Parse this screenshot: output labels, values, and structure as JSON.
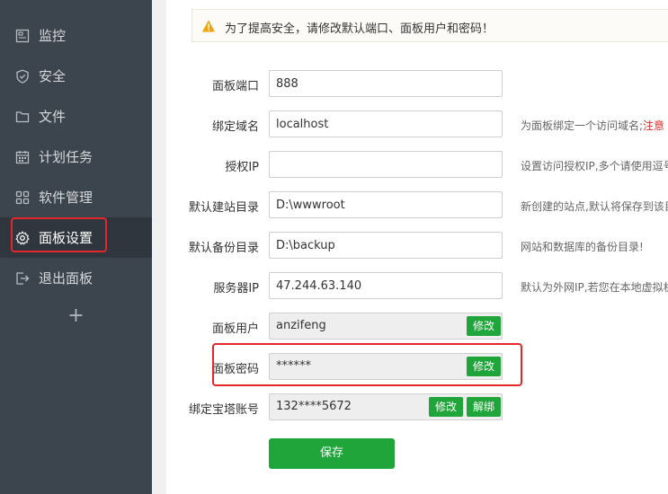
{
  "sidebar": {
    "items": [
      {
        "label": "监控",
        "icon": "monitor-icon"
      },
      {
        "label": "安全",
        "icon": "shield-icon"
      },
      {
        "label": "文件",
        "icon": "folder-icon"
      },
      {
        "label": "计划任务",
        "icon": "calendar-icon"
      },
      {
        "label": "软件管理",
        "icon": "apps-icon"
      },
      {
        "label": "面板设置",
        "icon": "gear-icon"
      },
      {
        "label": "退出面板",
        "icon": "logout-icon"
      }
    ],
    "add_label": "+"
  },
  "alert": {
    "message": "为了提高安全，请修改默认端口、面板用户和密码！",
    "icon": "warning-icon",
    "color": "#f0a30a"
  },
  "form": {
    "port": {
      "label": "面板端口",
      "value": "888"
    },
    "domain": {
      "label": "绑定域名",
      "value": "localhost",
      "hint": "为面板绑定一个访问域名;",
      "hint_red": "注意"
    },
    "auth_ip": {
      "label": "授权IP",
      "value": "",
      "hint": "设置访问授权IP,多个请使用逗号"
    },
    "site_dir": {
      "label": "默认建站目录",
      "value": "D:\\wwwroot",
      "hint": "新创建的站点,默认将保存到该目"
    },
    "backup_dir": {
      "label": "默认备份目录",
      "value": "D:\\backup",
      "hint": "网站和数据库的备份目录!"
    },
    "server_ip": {
      "label": "服务器IP",
      "value": "47.244.63.140",
      "hint": "默认为外网IP,若您在本地虚拟机"
    },
    "panel_user": {
      "label": "面板用户",
      "value": "anzifeng",
      "edit_label": "修改"
    },
    "panel_password": {
      "label": "面板密码",
      "value": "******",
      "edit_label": "修改"
    },
    "bt_account": {
      "label": "绑定宝塔账号",
      "value": "132****5672",
      "edit_label": "修改",
      "unbind_label": "解绑"
    },
    "save_label": "保存"
  },
  "colors": {
    "accent": "#20a53a",
    "sidebar_bg": "#3c444d",
    "highlight": "#e3262a"
  }
}
